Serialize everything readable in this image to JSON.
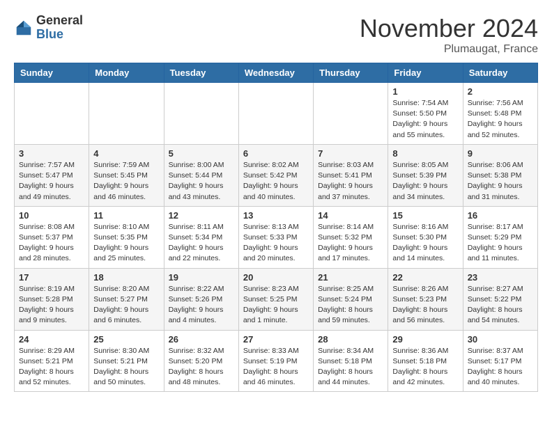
{
  "header": {
    "logo_general": "General",
    "logo_blue": "Blue",
    "month_title": "November 2024",
    "location": "Plumaugat, France"
  },
  "days_of_week": [
    "Sunday",
    "Monday",
    "Tuesday",
    "Wednesday",
    "Thursday",
    "Friday",
    "Saturday"
  ],
  "weeks": [
    [
      {
        "day": "",
        "info": ""
      },
      {
        "day": "",
        "info": ""
      },
      {
        "day": "",
        "info": ""
      },
      {
        "day": "",
        "info": ""
      },
      {
        "day": "",
        "info": ""
      },
      {
        "day": "1",
        "info": "Sunrise: 7:54 AM\nSunset: 5:50 PM\nDaylight: 9 hours and 55 minutes."
      },
      {
        "day": "2",
        "info": "Sunrise: 7:56 AM\nSunset: 5:48 PM\nDaylight: 9 hours and 52 minutes."
      }
    ],
    [
      {
        "day": "3",
        "info": "Sunrise: 7:57 AM\nSunset: 5:47 PM\nDaylight: 9 hours and 49 minutes."
      },
      {
        "day": "4",
        "info": "Sunrise: 7:59 AM\nSunset: 5:45 PM\nDaylight: 9 hours and 46 minutes."
      },
      {
        "day": "5",
        "info": "Sunrise: 8:00 AM\nSunset: 5:44 PM\nDaylight: 9 hours and 43 minutes."
      },
      {
        "day": "6",
        "info": "Sunrise: 8:02 AM\nSunset: 5:42 PM\nDaylight: 9 hours and 40 minutes."
      },
      {
        "day": "7",
        "info": "Sunrise: 8:03 AM\nSunset: 5:41 PM\nDaylight: 9 hours and 37 minutes."
      },
      {
        "day": "8",
        "info": "Sunrise: 8:05 AM\nSunset: 5:39 PM\nDaylight: 9 hours and 34 minutes."
      },
      {
        "day": "9",
        "info": "Sunrise: 8:06 AM\nSunset: 5:38 PM\nDaylight: 9 hours and 31 minutes."
      }
    ],
    [
      {
        "day": "10",
        "info": "Sunrise: 8:08 AM\nSunset: 5:37 PM\nDaylight: 9 hours and 28 minutes."
      },
      {
        "day": "11",
        "info": "Sunrise: 8:10 AM\nSunset: 5:35 PM\nDaylight: 9 hours and 25 minutes."
      },
      {
        "day": "12",
        "info": "Sunrise: 8:11 AM\nSunset: 5:34 PM\nDaylight: 9 hours and 22 minutes."
      },
      {
        "day": "13",
        "info": "Sunrise: 8:13 AM\nSunset: 5:33 PM\nDaylight: 9 hours and 20 minutes."
      },
      {
        "day": "14",
        "info": "Sunrise: 8:14 AM\nSunset: 5:32 PM\nDaylight: 9 hours and 17 minutes."
      },
      {
        "day": "15",
        "info": "Sunrise: 8:16 AM\nSunset: 5:30 PM\nDaylight: 9 hours and 14 minutes."
      },
      {
        "day": "16",
        "info": "Sunrise: 8:17 AM\nSunset: 5:29 PM\nDaylight: 9 hours and 11 minutes."
      }
    ],
    [
      {
        "day": "17",
        "info": "Sunrise: 8:19 AM\nSunset: 5:28 PM\nDaylight: 9 hours and 9 minutes."
      },
      {
        "day": "18",
        "info": "Sunrise: 8:20 AM\nSunset: 5:27 PM\nDaylight: 9 hours and 6 minutes."
      },
      {
        "day": "19",
        "info": "Sunrise: 8:22 AM\nSunset: 5:26 PM\nDaylight: 9 hours and 4 minutes."
      },
      {
        "day": "20",
        "info": "Sunrise: 8:23 AM\nSunset: 5:25 PM\nDaylight: 9 hours and 1 minute."
      },
      {
        "day": "21",
        "info": "Sunrise: 8:25 AM\nSunset: 5:24 PM\nDaylight: 8 hours and 59 minutes."
      },
      {
        "day": "22",
        "info": "Sunrise: 8:26 AM\nSunset: 5:23 PM\nDaylight: 8 hours and 56 minutes."
      },
      {
        "day": "23",
        "info": "Sunrise: 8:27 AM\nSunset: 5:22 PM\nDaylight: 8 hours and 54 minutes."
      }
    ],
    [
      {
        "day": "24",
        "info": "Sunrise: 8:29 AM\nSunset: 5:21 PM\nDaylight: 8 hours and 52 minutes."
      },
      {
        "day": "25",
        "info": "Sunrise: 8:30 AM\nSunset: 5:21 PM\nDaylight: 8 hours and 50 minutes."
      },
      {
        "day": "26",
        "info": "Sunrise: 8:32 AM\nSunset: 5:20 PM\nDaylight: 8 hours and 48 minutes."
      },
      {
        "day": "27",
        "info": "Sunrise: 8:33 AM\nSunset: 5:19 PM\nDaylight: 8 hours and 46 minutes."
      },
      {
        "day": "28",
        "info": "Sunrise: 8:34 AM\nSunset: 5:18 PM\nDaylight: 8 hours and 44 minutes."
      },
      {
        "day": "29",
        "info": "Sunrise: 8:36 AM\nSunset: 5:18 PM\nDaylight: 8 hours and 42 minutes."
      },
      {
        "day": "30",
        "info": "Sunrise: 8:37 AM\nSunset: 5:17 PM\nDaylight: 8 hours and 40 minutes."
      }
    ]
  ]
}
